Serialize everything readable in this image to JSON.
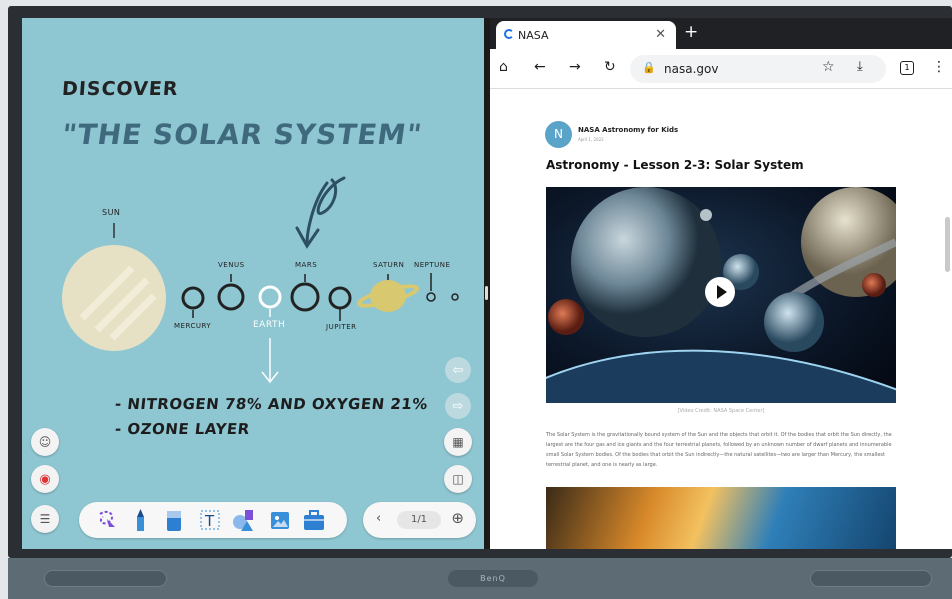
{
  "whiteboard": {
    "heading": "DISCOVER",
    "title": "\"THE SOLAR SYSTEM\"",
    "labels": {
      "sun": "SUN",
      "venus": "VENUS",
      "mars": "MARS",
      "saturn": "SATURN",
      "neptune": "NEPTUNE",
      "mercury": "MERCURY",
      "earth": "EARTH",
      "jupiter": "JUPITER"
    },
    "bullets": [
      "- NITROGEN 78% AND OXYGEN 21%",
      "- OZONE LAYER"
    ],
    "page_indicator": "1/1",
    "colors": {
      "board": "#8ec6d2",
      "title": "#3f6a7d"
    }
  },
  "browser": {
    "tab_title": "NASA",
    "url": "nasa.gov",
    "article": {
      "author": "NASA Astronomy for Kids",
      "avatar_letter": "N",
      "date": "April 1, 2022",
      "headline": "Astronomy - Lesson 2-3:  Solar System",
      "caption": "[Video Credit: NASA Space Center]",
      "body": "The Solar System is the gravitationally bound system of the Sun and the objects that orbit it. Of the bodies that orbit the Sun directly, the largest are the four gas and ice giants and the four terrestrial planets, followed by an unknown number of dwarf planets and innumerable small Solar System bodies. Of the bodies that orbit the Sun indirectly—the natural satellites—two are larger than Mercury, the smallest terrestrial planet, and one is nearly as large."
    },
    "tab_count": "1"
  },
  "stand": {
    "brand": "BenQ"
  }
}
